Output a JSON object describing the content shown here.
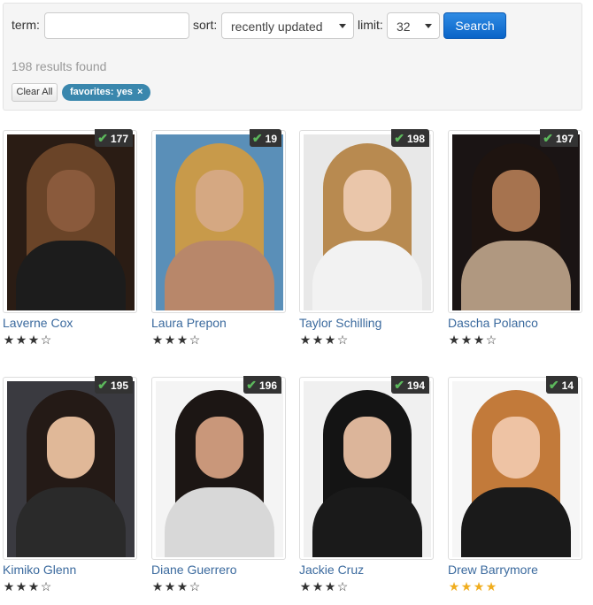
{
  "search": {
    "term_label": "term:",
    "term_value": "",
    "sort_label": "sort:",
    "sort_value": "recently updated",
    "limit_label": "limit:",
    "limit_value": "32",
    "button_label": "Search"
  },
  "results_text": "198 results found",
  "clear_label": "Clear All",
  "filter_chip": {
    "label": "favorites: yes",
    "remove": "×"
  },
  "colors": {
    "accent": "#0a64c8",
    "chip": "#3a87ad",
    "link": "#3b6a9e",
    "star_gold": "#f0ad1e",
    "star_dark": "#333333",
    "check": "#5cb85c"
  },
  "cards": [
    {
      "name": "Laverne Cox",
      "count": "177",
      "rating": 3,
      "star_color": "#333333",
      "palette": [
        "#2a1c14",
        "#6a4428",
        "#8a5a3c",
        "#1c1c1c"
      ]
    },
    {
      "name": "Laura Prepon",
      "count": "19",
      "rating": 3,
      "star_color": "#333333",
      "palette": [
        "#5a8fb8",
        "#c89a4a",
        "#d5a882",
        "#b8876a"
      ]
    },
    {
      "name": "Taylor Schilling",
      "count": "198",
      "rating": 3,
      "star_color": "#333333",
      "palette": [
        "#e8e8e8",
        "#b88a50",
        "#eac6aa",
        "#f2f2f2"
      ]
    },
    {
      "name": "Dascha Polanco",
      "count": "197",
      "rating": 3,
      "star_color": "#333333",
      "palette": [
        "#1a1414",
        "#1e1410",
        "#a6734f",
        "#b09880"
      ]
    },
    {
      "name": "Kimiko Glenn",
      "count": "195",
      "rating": 3,
      "star_color": "#333333",
      "palette": [
        "#3a3a40",
        "#241a16",
        "#e0b898",
        "#2a2a2a"
      ]
    },
    {
      "name": "Diane Guerrero",
      "count": "196",
      "rating": 3,
      "star_color": "#333333",
      "palette": [
        "#f4f4f4",
        "#1c1614",
        "#c9977a",
        "#d8d8d8"
      ]
    },
    {
      "name": "Jackie Cruz",
      "count": "194",
      "rating": 3,
      "star_color": "#333333",
      "palette": [
        "#f0f0f0",
        "#141414",
        "#dcb59a",
        "#1a1a1a"
      ]
    },
    {
      "name": "Drew Barrymore",
      "count": "14",
      "rating": 4,
      "star_color": "#f0ad1e",
      "palette": [
        "#f6f6f6",
        "#c27a3a",
        "#eec3a4",
        "#1a1a1a"
      ]
    }
  ]
}
